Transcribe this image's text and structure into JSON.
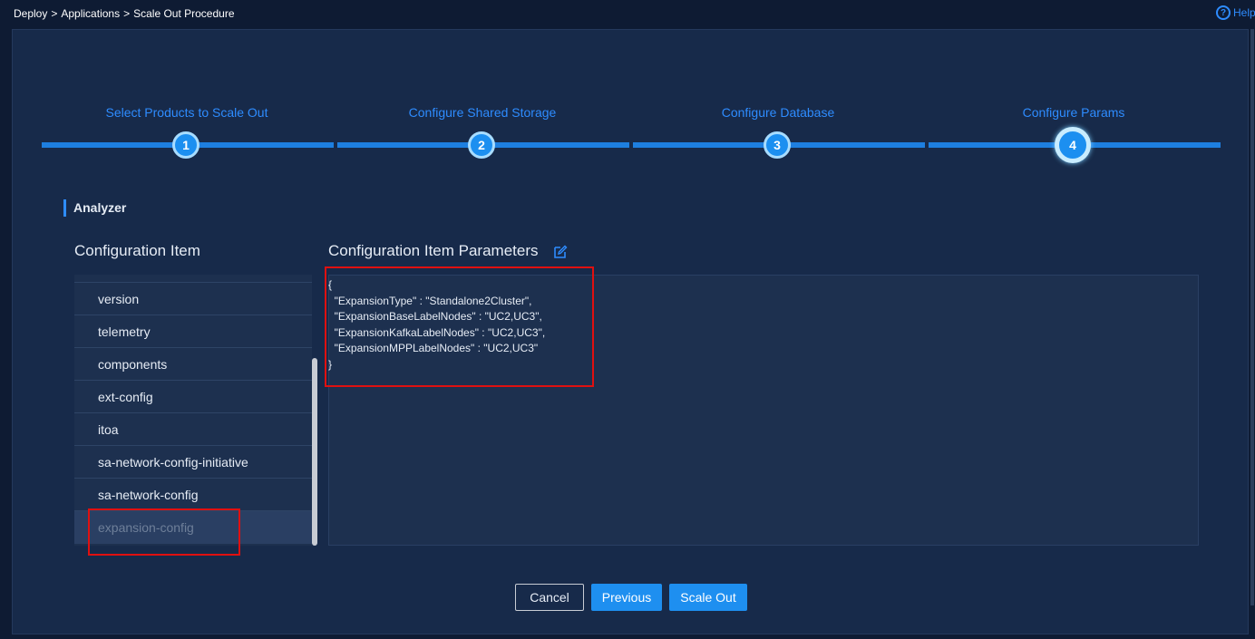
{
  "breadcrumb": {
    "items": [
      "Deploy",
      "Applications",
      "Scale Out Procedure"
    ],
    "separator": ">"
  },
  "help": {
    "label": "Help"
  },
  "steps": [
    {
      "label": "Select Products to Scale Out",
      "number": "1"
    },
    {
      "label": "Configure Shared Storage",
      "number": "2"
    },
    {
      "label": "Configure Database",
      "number": "3"
    },
    {
      "label": "Configure Params",
      "number": "4"
    }
  ],
  "active_step": 4,
  "section": {
    "title": "Analyzer"
  },
  "config_items": {
    "title": "Configuration Item",
    "items": [
      "version",
      "telemetry",
      "components",
      "ext-config",
      "itoa",
      "sa-network-config-initiative",
      "sa-network-config",
      "expansion-config"
    ],
    "selected": "expansion-config"
  },
  "params": {
    "title": "Configuration Item Parameters",
    "edit_icon": "edit-icon",
    "json_lines": [
      "{",
      "  \"ExpansionType\" : \"Standalone2Cluster\",",
      "  \"ExpansionBaseLabelNodes\" : \"UC2,UC3\",",
      "  \"ExpansionKafkaLabelNodes\" : \"UC2,UC3\",",
      "  \"ExpansionMPPLabelNodes\" : \"UC2,UC3\"",
      "}"
    ]
  },
  "buttons": {
    "cancel": "Cancel",
    "previous": "Previous",
    "scale_out": "Scale Out"
  },
  "colors": {
    "accent": "#1e8ff0",
    "highlight": "#e01010",
    "background": "#0e1b33"
  }
}
